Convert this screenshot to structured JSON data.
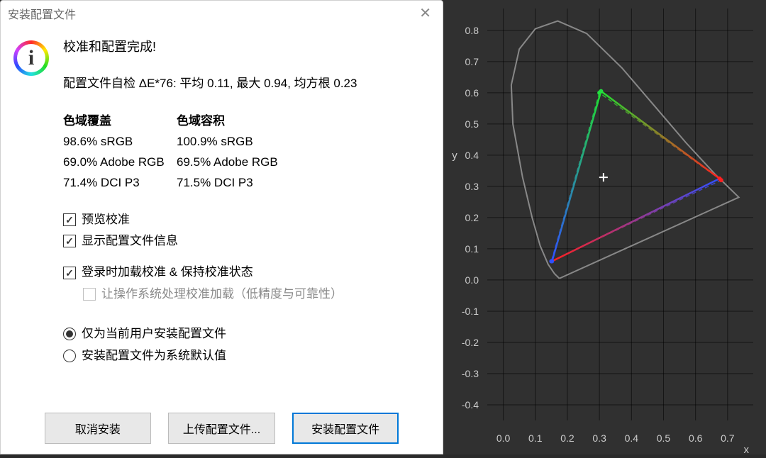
{
  "dialog": {
    "title": "安装配置文件",
    "headline": "校准和配置完成!",
    "stats_line": "配置文件自检 ΔE*76: 平均 0.11, 最大 0.94, 均方根 0.23",
    "coverage_header": "色域覆盖",
    "volume_header": "色域容积",
    "coverage": {
      "srgb": "98.6% sRGB",
      "adobe": "69.0% Adobe RGB",
      "dcip3": "71.4% DCI P3"
    },
    "volume": {
      "srgb": "100.9% sRGB",
      "adobe": "69.5% Adobe RGB",
      "dcip3": "71.5% DCI P3"
    },
    "checks": {
      "preview": "预览校准",
      "show_info": "显示配置文件信息",
      "load_on_login": "登录时加载校准 & 保持校准状态",
      "os_handle": "让操作系统处理校准加载（低精度与可靠性）"
    },
    "radios": {
      "current_user": "仅为当前用户安装配置文件",
      "system_default": "安装配置文件为系统默认值"
    },
    "buttons": {
      "cancel": "取消安装",
      "upload": "上传配置文件...",
      "install": "安装配置文件"
    }
  },
  "chart_data": {
    "type": "scatter",
    "title": "",
    "xlabel": "x",
    "ylabel": "y",
    "xlim": [
      -0.05,
      0.78
    ],
    "ylim": [
      -0.45,
      0.87
    ],
    "x_ticks": [
      0.0,
      0.1,
      0.2,
      0.3,
      0.4,
      0.5,
      0.6,
      0.7
    ],
    "y_ticks": [
      -0.4,
      -0.3,
      -0.2,
      -0.1,
      0.0,
      0.1,
      0.2,
      0.3,
      0.4,
      0.5,
      0.6,
      0.7,
      0.8
    ],
    "spectral_locus": [
      [
        0.175,
        0.005
      ],
      [
        0.16,
        0.02
      ],
      [
        0.14,
        0.05
      ],
      [
        0.115,
        0.11
      ],
      [
        0.09,
        0.2
      ],
      [
        0.06,
        0.33
      ],
      [
        0.03,
        0.5
      ],
      [
        0.025,
        0.625
      ],
      [
        0.05,
        0.74
      ],
      [
        0.1,
        0.805
      ],
      [
        0.17,
        0.83
      ],
      [
        0.26,
        0.79
      ],
      [
        0.37,
        0.68
      ],
      [
        0.47,
        0.56
      ],
      [
        0.57,
        0.44
      ],
      [
        0.66,
        0.34
      ],
      [
        0.735,
        0.265
      ],
      [
        0.175,
        0.005
      ]
    ],
    "white_point": [
      0.3127,
      0.329
    ],
    "series": [
      {
        "name": "measured_gamut",
        "type": "triangle",
        "vertices": [
          [
            0.675,
            0.325
          ],
          [
            0.305,
            0.605
          ],
          [
            0.152,
            0.06
          ]
        ],
        "edge_colors": [
          "#ff3030",
          "#22e040",
          "#3060ff"
        ]
      },
      {
        "name": "reference_gamut",
        "type": "triangle_dashed",
        "vertices": [
          [
            0.68,
            0.32
          ],
          [
            0.3,
            0.6
          ],
          [
            0.15,
            0.06
          ]
        ],
        "edge_colors": [
          "#ff5050",
          "#40e060",
          "#4070ff"
        ]
      }
    ]
  }
}
